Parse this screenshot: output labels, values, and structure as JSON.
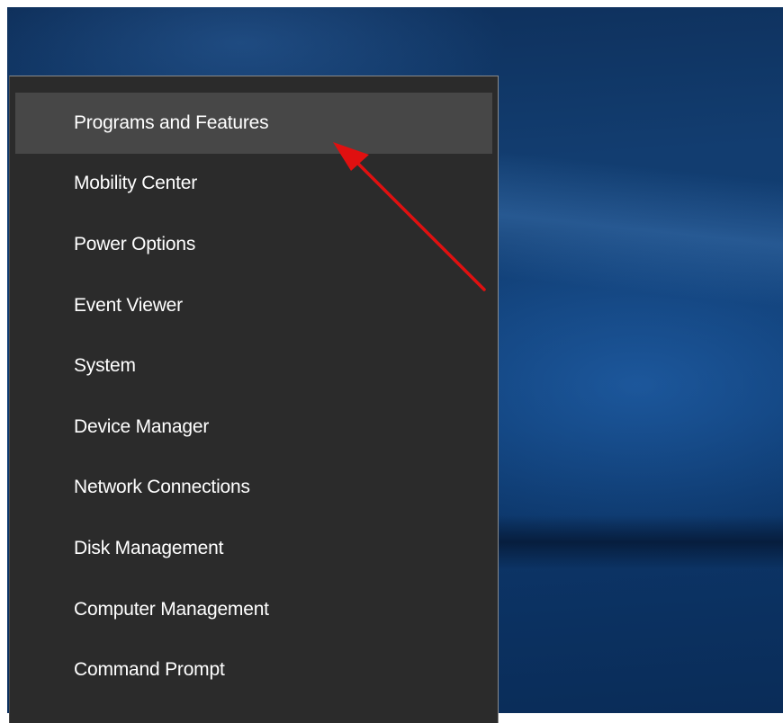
{
  "menu": {
    "items": [
      {
        "label": "Programs and Features",
        "highlighted": true
      },
      {
        "label": "Mobility Center"
      },
      {
        "label": "Power Options"
      },
      {
        "label": "Event Viewer"
      },
      {
        "label": "System"
      },
      {
        "label": "Device Manager"
      },
      {
        "label": "Network Connections"
      },
      {
        "label": "Disk Management"
      },
      {
        "label": "Computer Management"
      },
      {
        "label": "Command Prompt"
      }
    ]
  },
  "colors": {
    "menu_background": "#2b2b2b",
    "menu_highlight": "#474747",
    "menu_text": "#ffffff",
    "annotation_arrow": "#e01010",
    "desktop_blue": "#0f3c72"
  }
}
